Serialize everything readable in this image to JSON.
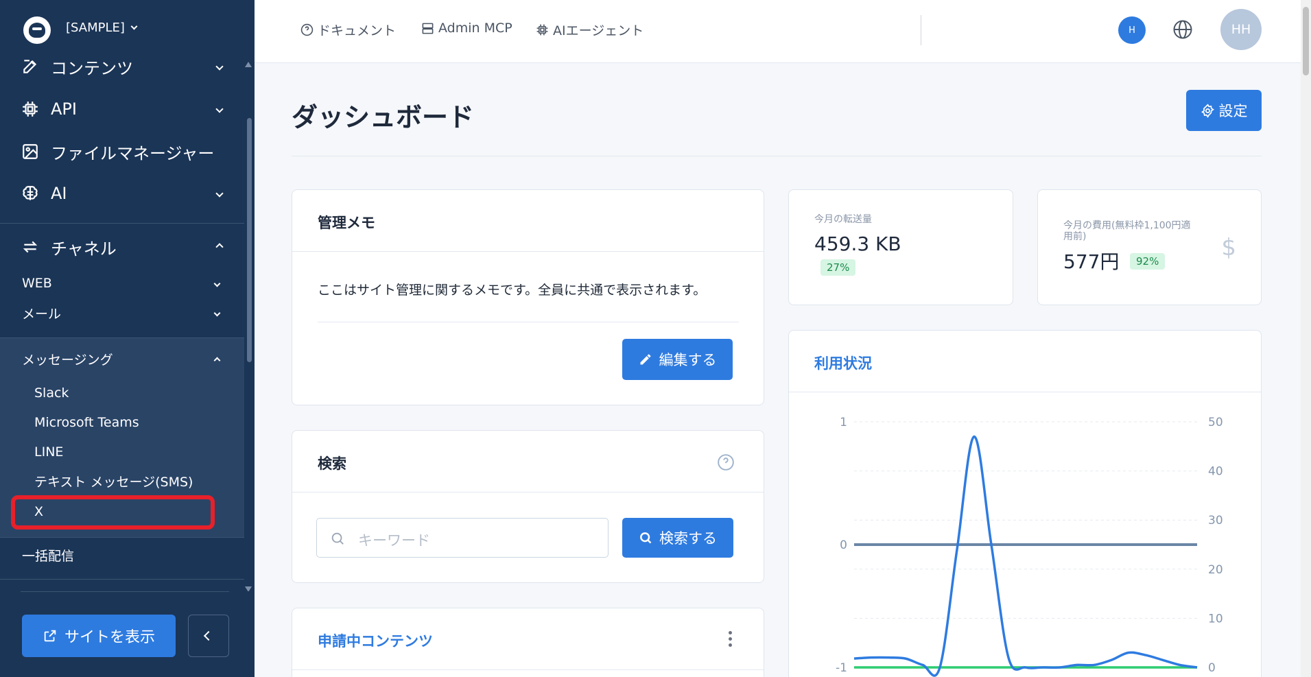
{
  "sidebar": {
    "site_name": "[SAMPLE]",
    "items": [
      {
        "label": "コンテンツ",
        "icon": "edit-icon"
      },
      {
        "label": "API",
        "icon": "chip-icon"
      },
      {
        "label": "ファイルマネージャー",
        "icon": "image-icon"
      },
      {
        "label": "AI",
        "icon": "brain-icon"
      },
      {
        "label": "チャネル",
        "icon": "arrows-exchange-icon"
      }
    ],
    "channels": {
      "web": "WEB",
      "mail": "メール",
      "messaging": "メッセージング",
      "messaging_items": [
        "Slack",
        "Microsoft Teams",
        "LINE",
        "テキスト メッセージ(SMS)",
        "X"
      ],
      "bulk": "一括配信"
    },
    "view_site_label": "サイトを表示"
  },
  "topbar": {
    "links": [
      {
        "label": "ドキュメント",
        "icon": "help-circle-icon"
      },
      {
        "label": "Admin MCP",
        "icon": "server-icon"
      },
      {
        "label": "AIエージェント",
        "icon": "chip-icon"
      }
    ],
    "small_avatar": "H",
    "big_avatar": "HH"
  },
  "page": {
    "title": "ダッシュボード",
    "settings_label": "設定"
  },
  "memo": {
    "title": "管理メモ",
    "text": "ここはサイト管理に関するメモです。全員に共通で表示されます。",
    "edit_label": "編集する"
  },
  "search": {
    "title": "検索",
    "placeholder": "キーワード",
    "button_label": "検索する"
  },
  "pending": {
    "title": "申請中コンテンツ"
  },
  "stats": {
    "transfer_label": "今月の転送量",
    "transfer_value": "459.3 KB",
    "transfer_badge": "27%",
    "cost_label_line1": "今月の費用(無料枠1,100円適",
    "cost_label_line2": "用前)",
    "cost_value": "577円",
    "cost_badge": "92%",
    "currency_symbol": "$"
  },
  "usage": {
    "title": "利用状況"
  },
  "chart_data": {
    "type": "line",
    "left_axis": {
      "ticks": [
        "1",
        "0",
        "-1"
      ],
      "range": [
        -1,
        1
      ]
    },
    "right_axis": {
      "ticks": [
        "50",
        "40",
        "30",
        "20",
        "10",
        "0"
      ],
      "range": [
        0,
        50
      ]
    },
    "x": [
      0,
      1,
      2,
      3,
      4,
      5,
      6,
      7,
      8,
      9,
      10,
      11,
      12,
      13,
      14,
      15,
      16,
      17,
      18,
      19,
      20
    ],
    "series": [
      {
        "color": "#2e7be0",
        "axis": "right",
        "values": [
          1.8,
          2,
          2,
          1.8,
          0.5,
          0,
          24,
          47,
          25,
          2,
          0,
          0,
          0,
          0.5,
          0.5,
          1.5,
          3,
          2.5,
          1.5,
          0.5,
          0
        ]
      },
      {
        "color": "#6a86a6",
        "axis": "left",
        "values": [
          0,
          0,
          0,
          0,
          0,
          0,
          0,
          0,
          0,
          0,
          0,
          0,
          0,
          0,
          0,
          0,
          0,
          0,
          0,
          0,
          0
        ]
      },
      {
        "color": "#2ecc71",
        "axis": "right",
        "values": [
          0,
          0,
          0,
          0,
          0,
          0,
          0,
          0,
          0,
          0,
          0,
          0,
          0,
          0,
          0,
          0,
          0,
          0,
          0,
          0,
          0
        ]
      }
    ],
    "grid": true
  }
}
